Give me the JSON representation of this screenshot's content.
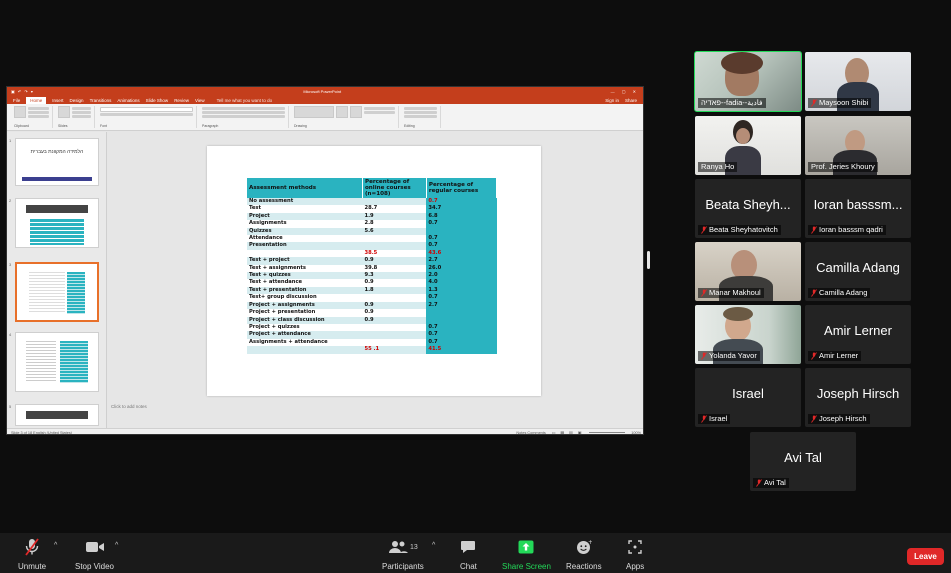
{
  "ppt": {
    "title": "Microsoft PowerPoint",
    "menu": [
      "File",
      "Home",
      "Insert",
      "Design",
      "Transitions",
      "Animations",
      "Slide Show",
      "Review",
      "View"
    ],
    "tell_me": "Tell me what you want to do",
    "sign_in": "Sign in",
    "share": "Share",
    "ribbon_groups": [
      "Clipboard",
      "Slides",
      "Font",
      "Paragraph",
      "Drawing",
      "Editing"
    ],
    "thumb1_text": "הלמידה המקוונת בעברית",
    "notes_placeholder": "Click to add notes",
    "status_left": "Slide 3 of 18   English (United States)",
    "status_right": "Notes   Comments",
    "zoom": "100%"
  },
  "table": {
    "headers": [
      "Assessment methods",
      "Percentage of online courses (n=108)",
      "Percentage of regular courses"
    ],
    "rows": [
      {
        "method": "No assessment",
        "online": "",
        "regular": "0.7",
        "regular_red": true
      },
      {
        "method": "Test",
        "online": "28.7",
        "regular": "34.7"
      },
      {
        "method": "Project",
        "online": "1.9",
        "regular": "6.8"
      },
      {
        "method": "Assignments",
        "online": "2.8",
        "regular": "0.7"
      },
      {
        "method": "Quizzes",
        "online": "5.6",
        "regular": ""
      },
      {
        "method": "Attendance",
        "online": "",
        "regular": "0.7"
      },
      {
        "method": "Presentation",
        "online": "",
        "regular": "0.7"
      },
      {
        "method": "",
        "online": "38.5",
        "online_red": true,
        "regular": "43.6",
        "regular_red": true
      },
      {
        "method": "Test + project",
        "online": "0.9",
        "regular": "2.7"
      },
      {
        "method": "Test + assignments",
        "online": "39.8",
        "regular": "26.0"
      },
      {
        "method": "Test + quizzes",
        "online": "9.3",
        "regular": "2.0"
      },
      {
        "method": "Test + attendance",
        "online": "0.9",
        "regular": "4.0"
      },
      {
        "method": "Test + presentation",
        "online": "1.8",
        "regular": "1.3"
      },
      {
        "method": "Test+ group discussion",
        "online": "",
        "regular": "0.7"
      },
      {
        "method": "Project + assignments",
        "online": "0.9",
        "regular": "2.7"
      },
      {
        "method": "Project + presentation",
        "online": "0.9",
        "regular": ""
      },
      {
        "method": "Project + class discussion",
        "online": "0.9",
        "regular": ""
      },
      {
        "method": "Project + quizzes",
        "online": "",
        "regular": "0.7"
      },
      {
        "method": "Project + attendance",
        "online": "",
        "regular": "0.7"
      },
      {
        "method": "Assignments + attendance",
        "online": "",
        "regular": "0.7"
      },
      {
        "method": "",
        "online": "55 .1",
        "online_red": true,
        "regular": "41.5",
        "regular_red": true
      }
    ]
  },
  "participants": {
    "fadia": {
      "name": "פאדיה--fadia--فادية"
    },
    "maysoon": {
      "name": "Maysoon Shibi"
    },
    "ranya": {
      "name": "Ranya Ho"
    },
    "jeries": {
      "name": "Prof. Jeries Khoury"
    },
    "beata": {
      "big": "Beata Sheyh...",
      "name": "Beata Sheyhatovitch"
    },
    "ioran": {
      "big": "Ioran basssm...",
      "name": "Ioran basssm qadri"
    },
    "manar": {
      "name": "Manar Makhoul"
    },
    "camilla": {
      "big": "Camilla Adang",
      "name": "Camilla Adang"
    },
    "yolanda": {
      "name": "Yolanda Yavor"
    },
    "amir": {
      "big": "Amir Lerner",
      "name": "Amir Lerner"
    },
    "israel": {
      "big": "Israel",
      "name": "Israel"
    },
    "joseph": {
      "big": "Joseph Hirsch",
      "name": "Joseph Hirsch"
    },
    "avi": {
      "big": "Avi Tal",
      "name": "Avi Tal"
    }
  },
  "toolbar": {
    "unmute": "Unmute",
    "stop_video": "Stop Video",
    "participants": "Participants",
    "participants_count": "13",
    "chat": "Chat",
    "share_screen": "Share Screen",
    "reactions": "Reactions",
    "apps": "Apps",
    "leave": "Leave"
  },
  "colors": {
    "ppt_accent": "#c43e1c",
    "table_teal": "#2ab3c0",
    "table_light": "#d6ecef",
    "active_speaker": "#23d959",
    "share_green": "#23d959",
    "leave_red": "#e02828",
    "muted_red": "#e02828"
  }
}
